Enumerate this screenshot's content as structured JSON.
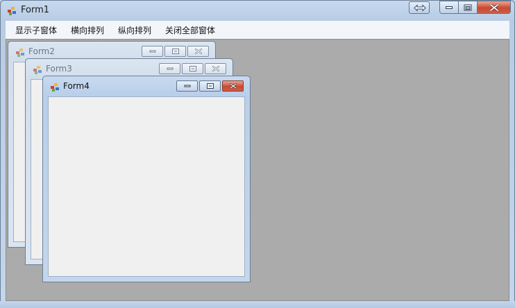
{
  "window": {
    "title": "Form1"
  },
  "menu": {
    "items": [
      {
        "label": "显示子窗体"
      },
      {
        "label": "横向排列"
      },
      {
        "label": "纵向排列"
      },
      {
        "label": "关闭全部窗体"
      }
    ]
  },
  "children": [
    {
      "title": "Form2",
      "state": "inactive"
    },
    {
      "title": "Form3",
      "state": "inactive"
    },
    {
      "title": "Form4",
      "state": "active"
    }
  ],
  "colors": {
    "mdi_background": "#ababab",
    "close_button": "#c84a32",
    "frame": "#b9cde6"
  }
}
